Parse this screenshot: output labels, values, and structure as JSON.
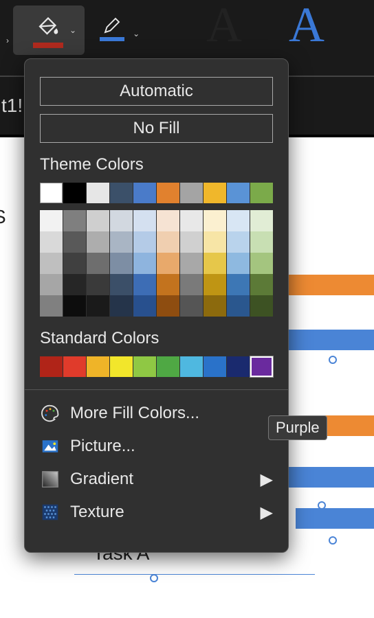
{
  "ribbon": {
    "fill_color": "#b02a1e",
    "border_color": "#3a78d6"
  },
  "formula": {
    "text": "t1!"
  },
  "dropdown": {
    "automatic": "Automatic",
    "no_fill": "No Fill",
    "theme_label": "Theme Colors",
    "theme_row": [
      "#ffffff",
      "#000000",
      "#e6e6e6",
      "#3b5069",
      "#4a7bc9",
      "#e1812e",
      "#a4a4a4",
      "#f0b72b",
      "#5a93d6",
      "#7baa4a"
    ],
    "tints": [
      [
        "#f2f2f2",
        "#7f7f7f",
        "#cfcfcf",
        "#d2d8e0",
        "#d4e0f0",
        "#f6e3d3",
        "#e8e8e8",
        "#fbf0d0",
        "#d8e6f4",
        "#e1edd5"
      ],
      [
        "#d9d9d9",
        "#595959",
        "#adadad",
        "#a9b5c4",
        "#b4cbe7",
        "#f0cfb0",
        "#d0d0d0",
        "#f7e5a6",
        "#b9d3ec",
        "#c8dfb3"
      ],
      [
        "#bfbfbf",
        "#404040",
        "#6e6e6e",
        "#7d8ea4",
        "#8eb4de",
        "#e8a96b",
        "#a8a8a8",
        "#e6c74a",
        "#8eb9e0",
        "#a4c57f"
      ],
      [
        "#a6a6a6",
        "#262626",
        "#3a3a3a",
        "#3b4f68",
        "#3d6db5",
        "#c3731e",
        "#7a7a7a",
        "#bf9514",
        "#3d77b5",
        "#5c7a37"
      ],
      [
        "#808080",
        "#0d0d0d",
        "#1a1a1a",
        "#25344a",
        "#28508e",
        "#8e4d10",
        "#555555",
        "#8c6a0d",
        "#2a578e",
        "#3d5223"
      ]
    ],
    "standard_label": "Standard Colors",
    "standard_row": [
      "#b02418",
      "#e03b2b",
      "#efb428",
      "#f2e62b",
      "#8fc844",
      "#4fa844",
      "#4fb8e0",
      "#2a72c9",
      "#1a2a6e",
      "#6a2a9e"
    ],
    "selected_standard": 9,
    "more_colors": "More Fill Colors...",
    "picture": "Picture...",
    "gradient": "Gradient",
    "texture": "Texture"
  },
  "tooltip": {
    "text": "Purple"
  },
  "chart": {
    "task_a": "Task A",
    "task_s": "S"
  }
}
